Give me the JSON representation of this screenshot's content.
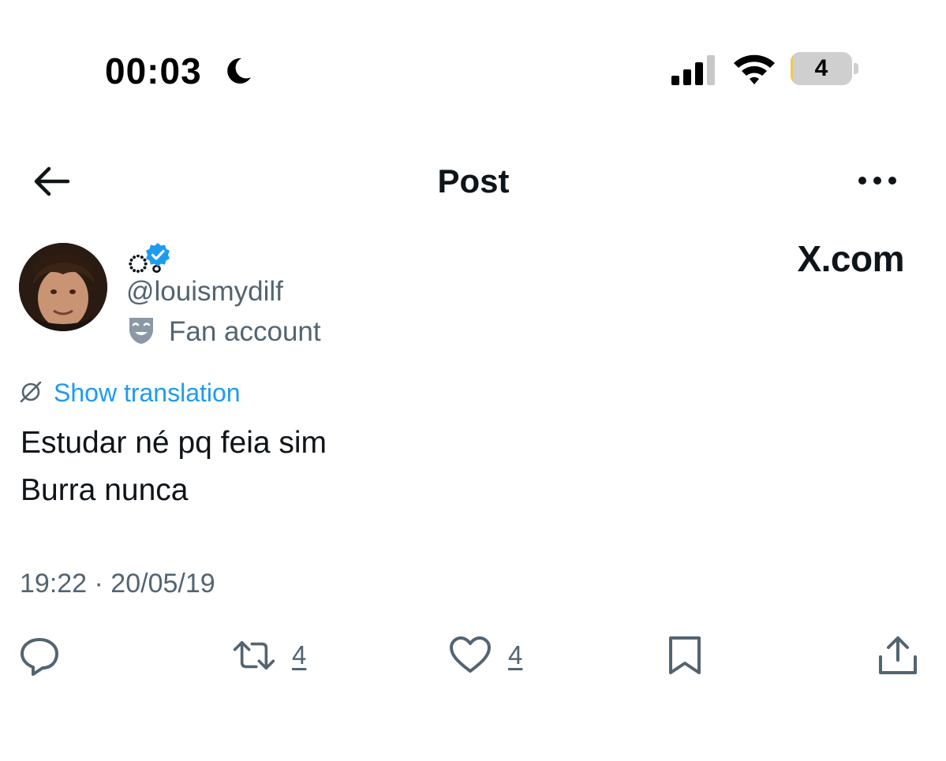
{
  "status_bar": {
    "time": "00:03",
    "focus_icon": "moon-icon",
    "signal_icon": "cellular-signal-icon",
    "wifi_icon": "wifi-icon",
    "battery_level": "4",
    "battery_fraction": 0.04,
    "battery_fill_color": "#f2c94c"
  },
  "nav": {
    "back_icon": "back-arrow-icon",
    "title": "Post",
    "more_icon": "more-options-icon"
  },
  "author": {
    "display_name": "ঃ",
    "verified_icon": "verified-badge-icon",
    "verified_color": "#1d9bf0",
    "handle": "@louismydilf",
    "label_icon": "theater-mask-icon",
    "label": "Fan account"
  },
  "watermark": "X.com",
  "post": {
    "translation_icon": "translate-globe-icon",
    "translation_link": "Show translation",
    "text": "Estudar né pq feia sim\nBurra nunca",
    "timestamp": "19:22 · 20/05/19"
  },
  "actions": {
    "reply": {
      "icon": "reply-icon"
    },
    "retweet": {
      "icon": "retweet-icon",
      "count": "4"
    },
    "like": {
      "icon": "heart-icon",
      "count": "4"
    },
    "bookmark": {
      "icon": "bookmark-icon"
    },
    "share": {
      "icon": "share-icon"
    }
  },
  "colors": {
    "text_primary": "#0f1419",
    "text_secondary": "#536471",
    "accent": "#1d9bf0"
  }
}
